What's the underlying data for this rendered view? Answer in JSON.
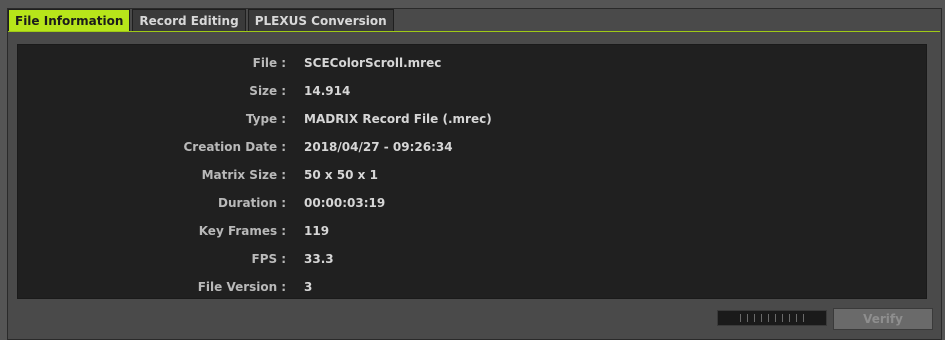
{
  "tabs": [
    {
      "label": "File Information",
      "active": true
    },
    {
      "label": "Record Editing",
      "active": false
    },
    {
      "label": "PLEXUS Conversion",
      "active": false
    }
  ],
  "colors": {
    "accent": "#b7e51a",
    "panel_bg": "#202020",
    "window_bg": "#4a4a4a"
  },
  "file_info": {
    "rows": [
      {
        "label": "File",
        "value": "SCEColorScroll.mrec"
      },
      {
        "label": "Size",
        "value": "14.914"
      },
      {
        "label": "Type",
        "value": "MADRIX Record File (.mrec)"
      },
      {
        "label": "Creation Date",
        "value": "2018/04/27 - 09:26:34"
      },
      {
        "label": "Matrix Size",
        "value": "50 x 50 x 1"
      },
      {
        "label": "Duration",
        "value": "00:00:03:19"
      },
      {
        "label": "Key Frames",
        "value": "119"
      },
      {
        "label": "FPS",
        "value": "33.3"
      },
      {
        "label": "File Version",
        "value": "3"
      }
    ]
  },
  "footer": {
    "verify_label": "Verify",
    "progress": 0
  }
}
